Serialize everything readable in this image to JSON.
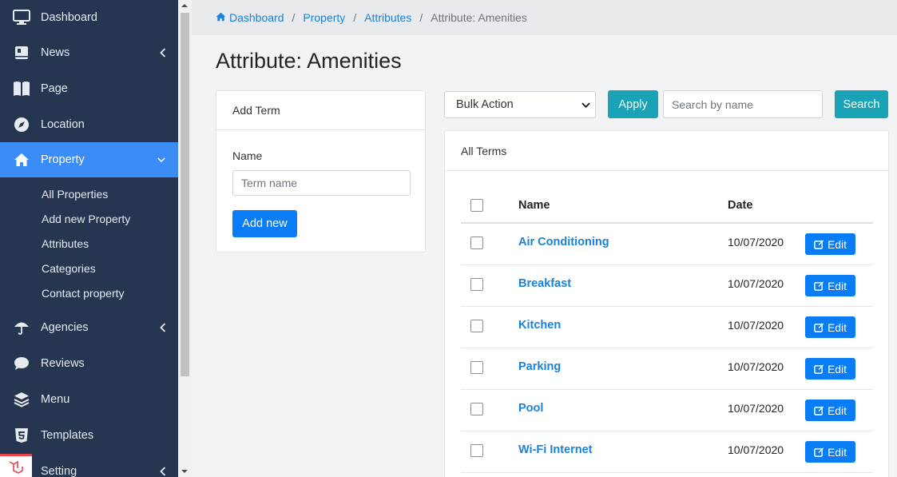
{
  "sidebar": {
    "items": [
      {
        "label": "Dashboard",
        "icon": "monitor-icon"
      },
      {
        "label": "News",
        "icon": "book-icon"
      },
      {
        "label": "Page",
        "icon": "page-icon"
      },
      {
        "label": "Location",
        "icon": "compass-icon"
      },
      {
        "label": "Property",
        "icon": "home-icon"
      },
      {
        "label": "Agencies",
        "icon": "umbrella-icon"
      },
      {
        "label": "Reviews",
        "icon": "comment-icon"
      },
      {
        "label": "Menu",
        "icon": "layers-icon"
      },
      {
        "label": "Templates",
        "icon": "html5-icon"
      },
      {
        "label": "Setting",
        "icon": "laravel-icon"
      }
    ],
    "property_sub": [
      "All Properties",
      "Add new Property",
      "Attributes",
      "Categories",
      "Contact property"
    ],
    "accent_color": "#3b8cf7",
    "bg_color": "#263550"
  },
  "breadcrumb": [
    "Dashboard",
    "Property",
    "Attributes",
    "Attribute: Amenities"
  ],
  "page_title": "Attribute: Amenities",
  "add_term": {
    "header": "Add Term",
    "name_label": "Name",
    "name_placeholder": "Term name",
    "submit_label": "Add new"
  },
  "toolbar": {
    "bulk_action": "Bulk Action",
    "apply_label": "Apply",
    "search_placeholder": "Search by name",
    "search_label": "Search"
  },
  "terms": {
    "header": "All Terms",
    "columns": {
      "name": "Name",
      "date": "Date"
    },
    "edit_label": "Edit",
    "rows": [
      {
        "name": "Air Conditioning",
        "date": "10/07/2020"
      },
      {
        "name": "Breakfast",
        "date": "10/07/2020"
      },
      {
        "name": "Kitchen",
        "date": "10/07/2020"
      },
      {
        "name": "Parking",
        "date": "10/07/2020"
      },
      {
        "name": "Pool",
        "date": "10/07/2020"
      },
      {
        "name": "Wi-Fi Internet",
        "date": "10/07/2020"
      }
    ]
  }
}
